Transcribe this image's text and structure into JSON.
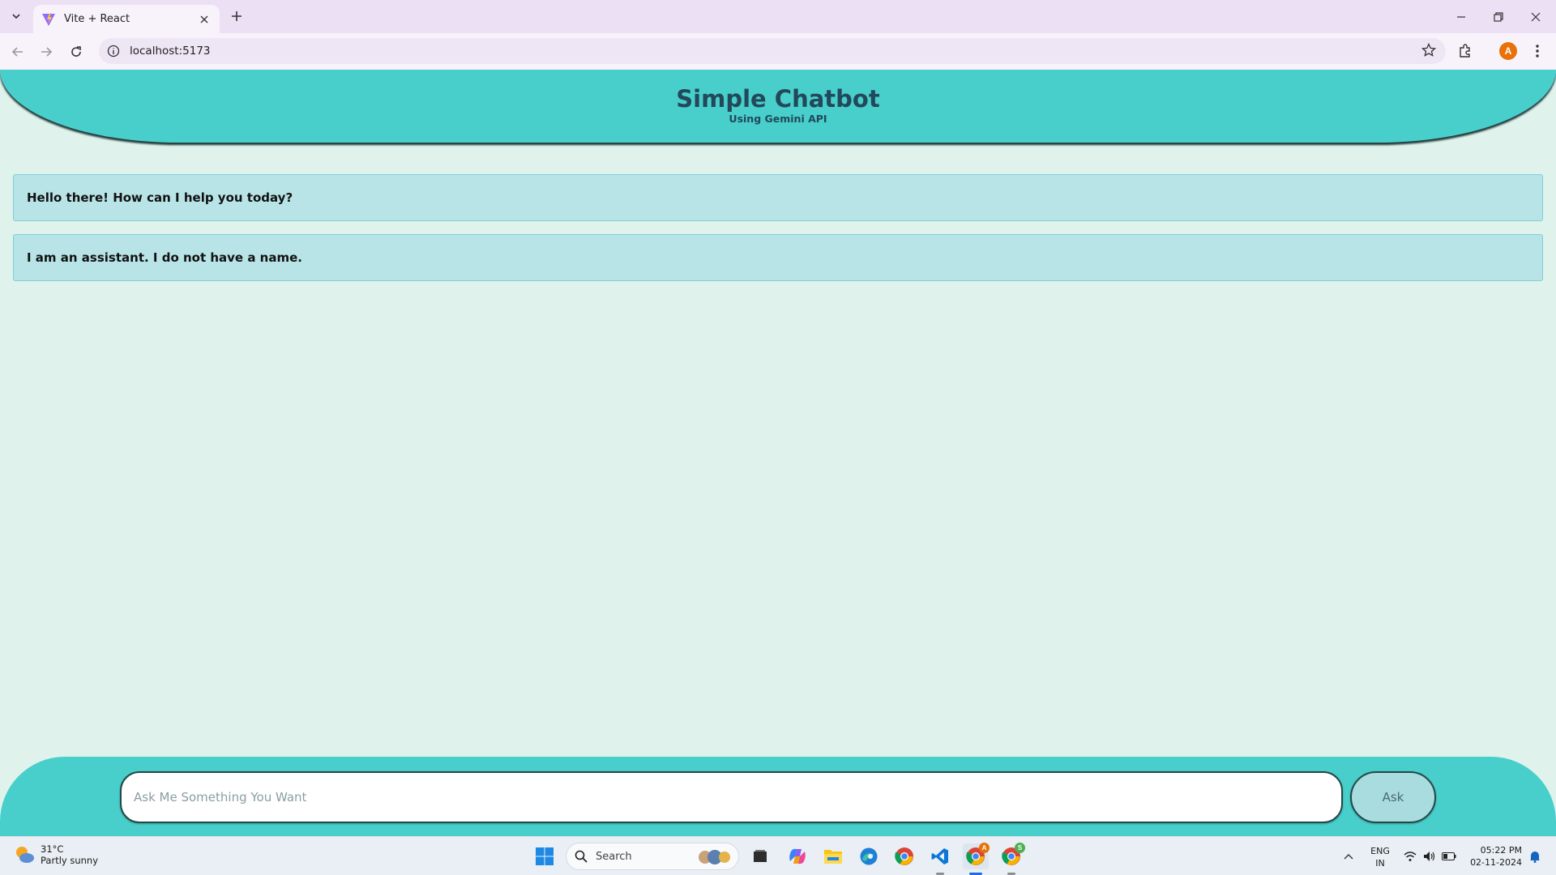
{
  "browser": {
    "tab_title": "Vite + React",
    "url": "localhost:5173",
    "profile_initial": "A"
  },
  "page": {
    "title": "Simple Chatbot",
    "subtitle": "Using Gemini API",
    "messages": [
      "Hello there! How can I help you today?",
      "I am an assistant. I do not have a name."
    ],
    "input_placeholder": "Ask Me Something You Want",
    "ask_label": "Ask"
  },
  "taskbar": {
    "weather_temp": "31°C",
    "weather_cond": "Partly sunny",
    "search_label": "Search",
    "lang_top": "ENG",
    "lang_bottom": "IN",
    "time": "05:22 PM",
    "date": "02-11-2024",
    "chrome_badge_1": "A",
    "chrome_badge_2": "S"
  },
  "colors": {
    "accent": "#48cfcb",
    "page_bg": "#e0f2ec",
    "title_color": "#22485a",
    "message_bg": "#b8e4e7"
  }
}
